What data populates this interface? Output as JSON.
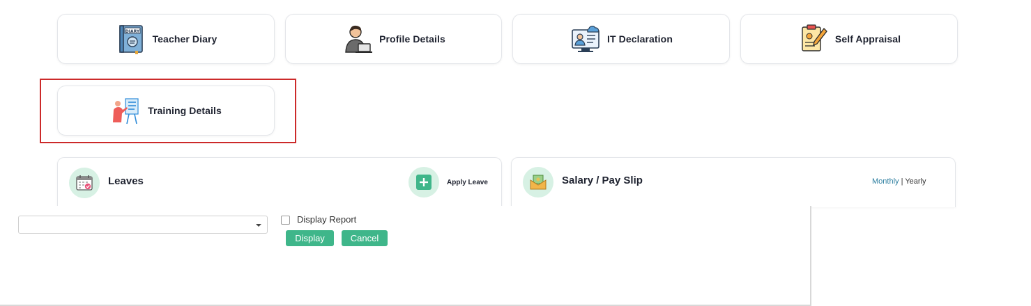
{
  "tiles": [
    {
      "label": "Teacher Diary",
      "icon": "diary-icon"
    },
    {
      "label": "Profile Details",
      "icon": "profile-icon"
    },
    {
      "label": "IT Declaration",
      "icon": "it-declaration-icon"
    },
    {
      "label": "Self Appraisal",
      "icon": "self-appraisal-icon"
    },
    {
      "label": "Training Details",
      "icon": "training-icon"
    }
  ],
  "diary_icon_text": "DIARY",
  "leaves": {
    "title": "Leaves",
    "apply_label": "Apply Leave"
  },
  "salary": {
    "title": "Salary / Pay Slip",
    "monthly": "Monthly",
    "separator": " | ",
    "yearly": "Yearly"
  },
  "report": {
    "select_value": "",
    "checkbox_label": "Display Report",
    "checkbox_checked": false,
    "display_button": "Display",
    "cancel_button": "Cancel"
  },
  "colors": {
    "accent": "#3fb68a",
    "highlight_border": "#cc2a2a",
    "link": "#2e7fa0"
  }
}
